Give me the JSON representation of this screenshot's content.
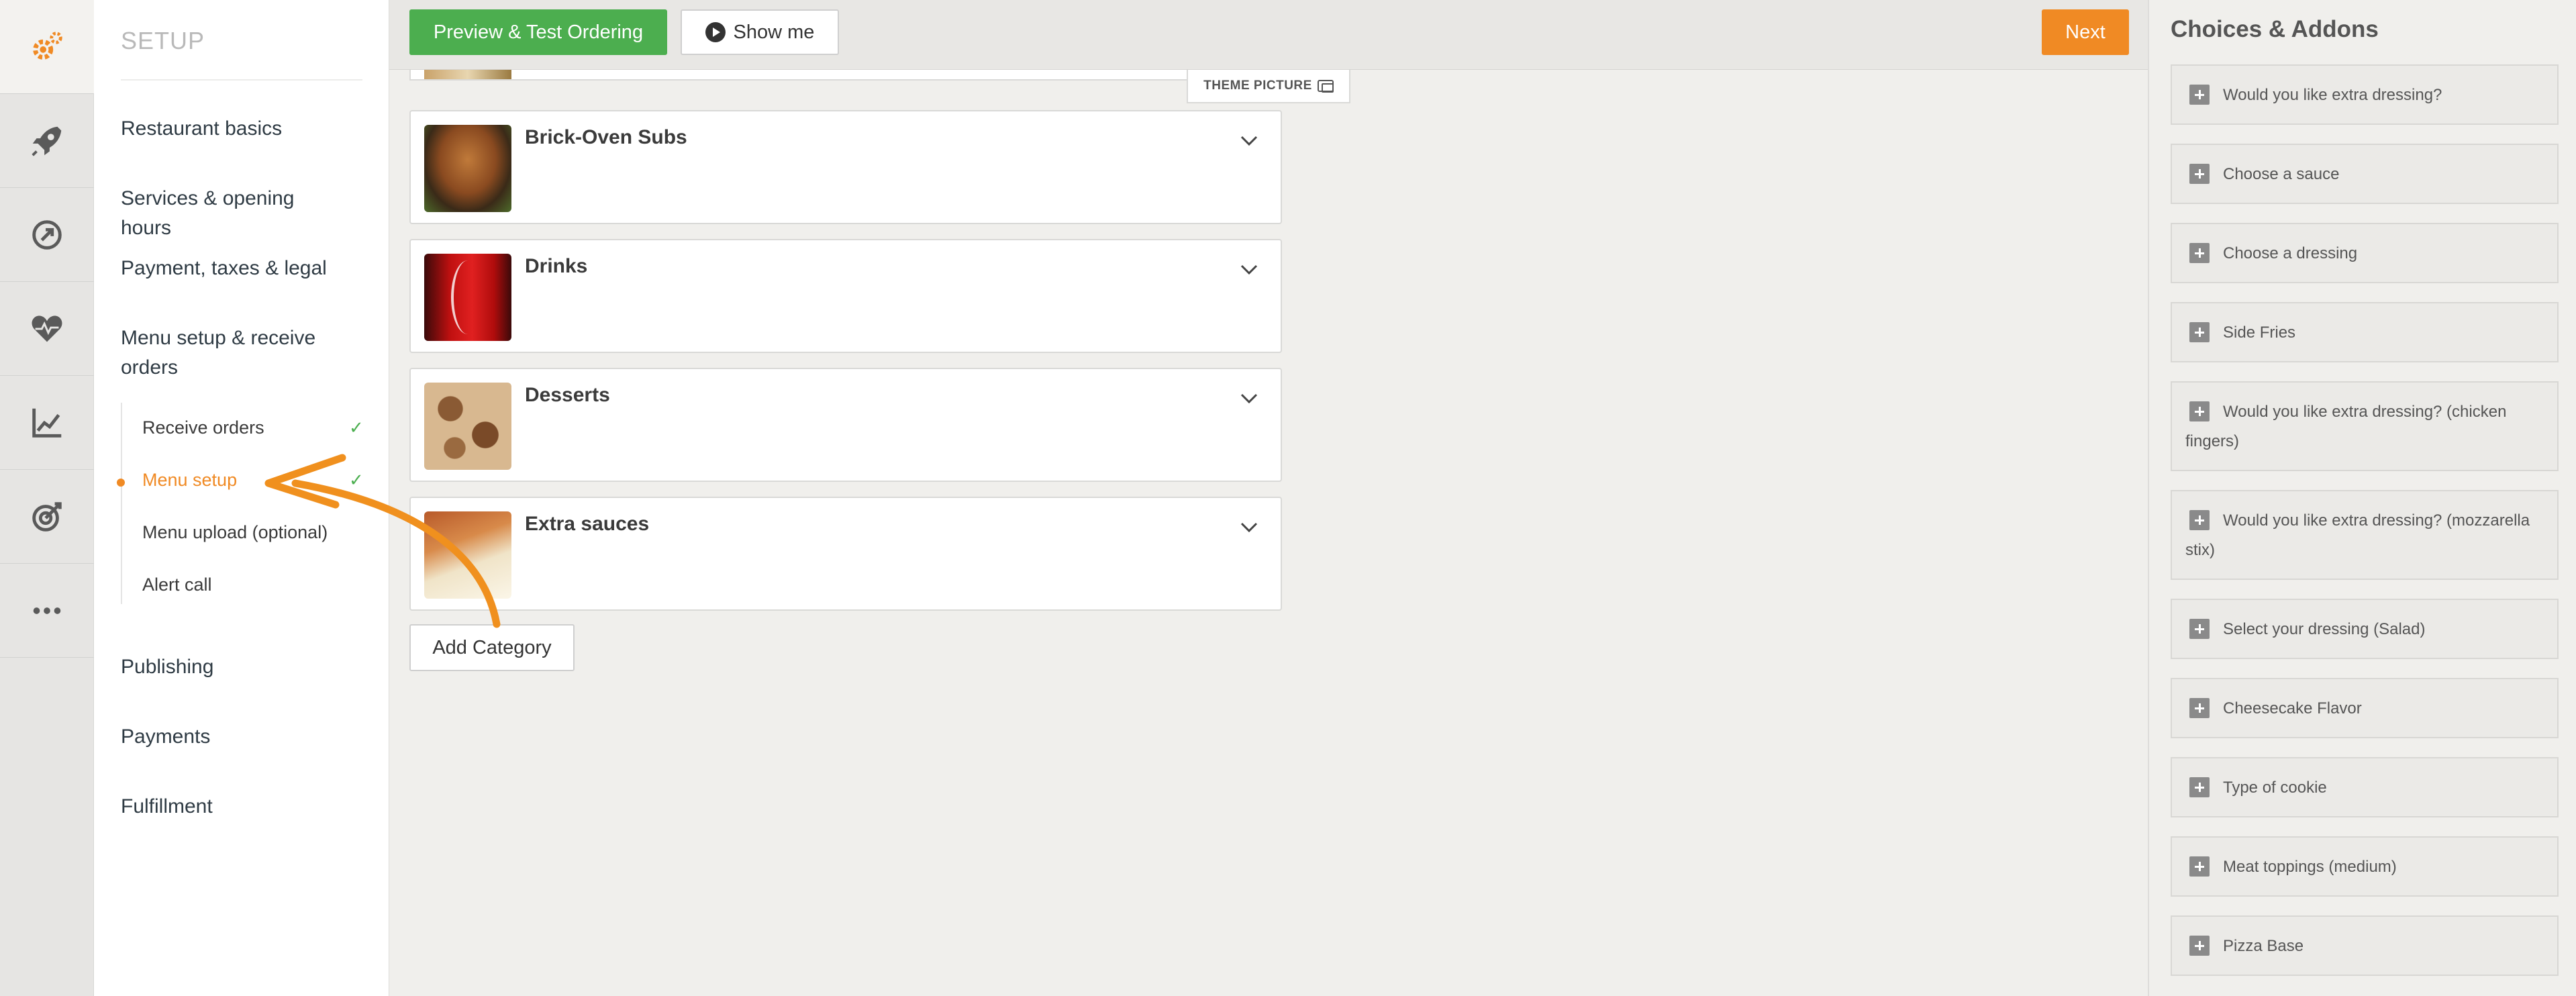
{
  "sidebar": {
    "title": "SETUP",
    "items": [
      {
        "label": "Restaurant basics"
      },
      {
        "label": "Services & opening hours"
      },
      {
        "label": "Payment, taxes & legal"
      },
      {
        "label": "Menu setup & receive orders"
      },
      {
        "label": "Publishing"
      },
      {
        "label": "Payments"
      },
      {
        "label": "Fulfillment"
      }
    ],
    "subitems": [
      {
        "label": "Receive orders",
        "done": true
      },
      {
        "label": "Menu setup",
        "done": true,
        "active": true
      },
      {
        "label": "Menu upload (optional)",
        "done": false
      },
      {
        "label": "Alert call",
        "done": false
      }
    ],
    "check_glyph": "✓"
  },
  "rail": {
    "icons": [
      "gears-logo-icon",
      "rocket-icon",
      "dashboard-arrow-icon",
      "heart-pulse-icon",
      "line-chart-icon",
      "target-icon",
      "more-dots-icon"
    ]
  },
  "toolbar": {
    "preview_label": "Preview & Test Ordering",
    "show_me_label": "Show me",
    "next_label": "Next"
  },
  "main": {
    "theme_picture_label": "THEME PICTURE",
    "categories": [
      {
        "name": "Brick-Oven Subs"
      },
      {
        "name": "Drinks"
      },
      {
        "name": "Desserts"
      },
      {
        "name": "Extra sauces"
      }
    ],
    "add_category_label": "Add Category"
  },
  "addons": {
    "title": "Choices & Addons",
    "items": [
      {
        "label": "Would you like extra dressing?"
      },
      {
        "label": "Choose a sauce"
      },
      {
        "label": "Choose a dressing"
      },
      {
        "label": "Side Fries"
      },
      {
        "label": "Would you like extra dressing? (chicken fingers)"
      },
      {
        "label": "Would you like extra dressing? (mozzarella stix)"
      },
      {
        "label": "Select your dressing (Salad)"
      },
      {
        "label": "Cheesecake Flavor"
      },
      {
        "label": "Type of cookie"
      },
      {
        "label": "Meat toppings (medium)"
      },
      {
        "label": "Pizza Base"
      }
    ]
  },
  "colors": {
    "accent": "#f08a24",
    "primary_green": "#4cae4f",
    "check_green": "#4caf50"
  }
}
